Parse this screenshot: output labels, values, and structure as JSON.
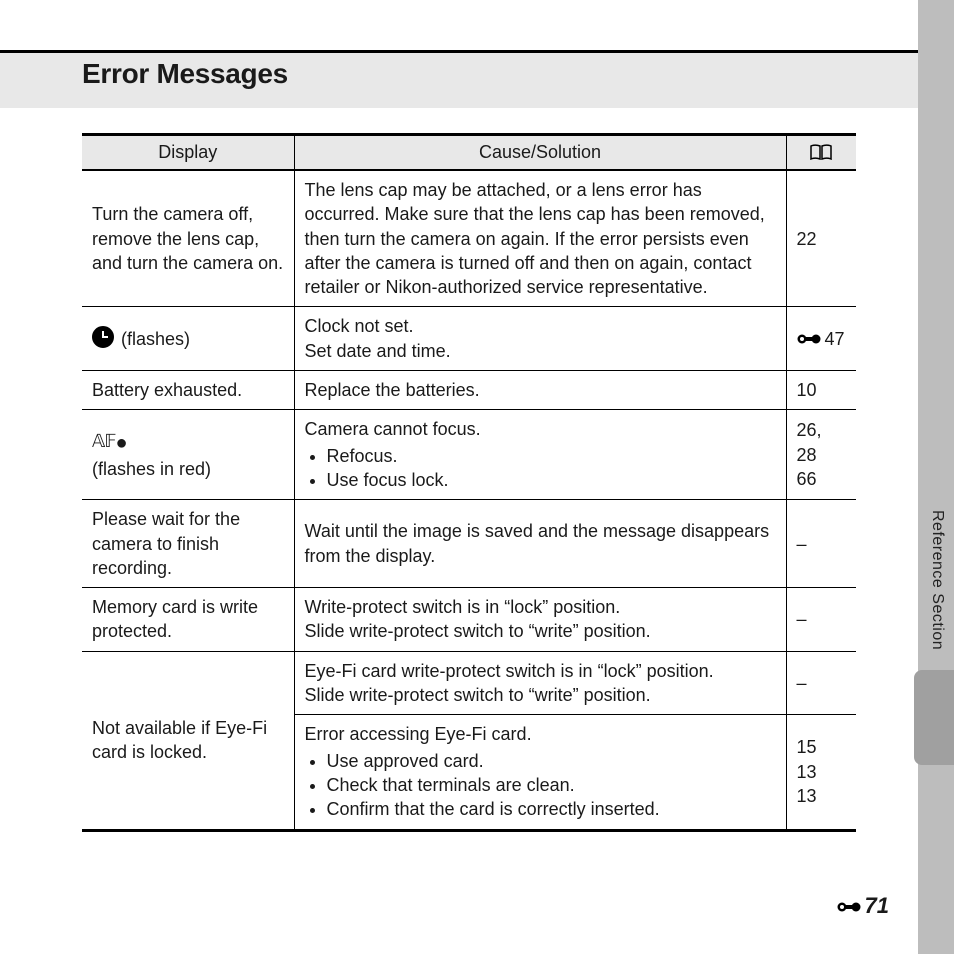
{
  "page": {
    "title": "Error Messages",
    "section_side_label": "Reference Section",
    "page_number": "71"
  },
  "table": {
    "headers": {
      "display": "Display",
      "cause": "Cause/Solution",
      "ref": "book-icon"
    },
    "rows": [
      {
        "display_text": "Turn the camera off, remove the lens cap, and turn the camera on.",
        "cause_text": "The lens cap may be attached, or a lens error has occurred. Make sure that the lens cap has been removed, then turn the camera on again. If the error persists even after the camera is turned off and then on again, contact retailer or Nikon-authorized service representative.",
        "ref_text": "22"
      },
      {
        "display_icon": "clock-icon",
        "display_text": " (flashes)",
        "cause_text": "Clock not set.\nSet date and time.",
        "ref_icon": "knob-icon",
        "ref_text": "47"
      },
      {
        "display_text": "Battery exhausted.",
        "cause_text": "Replace the batteries.",
        "ref_text": "10"
      },
      {
        "display_icon": "af-icon",
        "display_text": "\n(flashes in red)",
        "cause_pre_text": "Camera cannot focus.",
        "cause_bullets": [
          "Refocus.",
          "Use focus lock."
        ],
        "ref_text": "26, 28\n66"
      },
      {
        "display_text": "Please wait for the camera to finish recording.",
        "cause_text": "Wait until the image is saved and the message disappears from the display.",
        "ref_text": "–"
      },
      {
        "display_text": "Memory card is write protected.",
        "cause_text": "Write-protect switch is in “lock” position.\nSlide write-protect switch to “write” position.",
        "ref_text": "–"
      },
      {
        "display_text": "Not available if Eye-Fi card is locked.",
        "display_rowspan": 2,
        "cause_text": "Eye-Fi card write-protect switch is in “lock” position.\nSlide write-protect switch to “write” position.",
        "ref_text": "–"
      },
      {
        "display_skip": true,
        "cause_pre_text": "Error accessing Eye-Fi card.",
        "cause_bullets": [
          "Use approved card.",
          "Check that terminals are clean.",
          "Confirm that the card is correctly inserted."
        ],
        "ref_text": "15\n13\n13"
      }
    ]
  }
}
